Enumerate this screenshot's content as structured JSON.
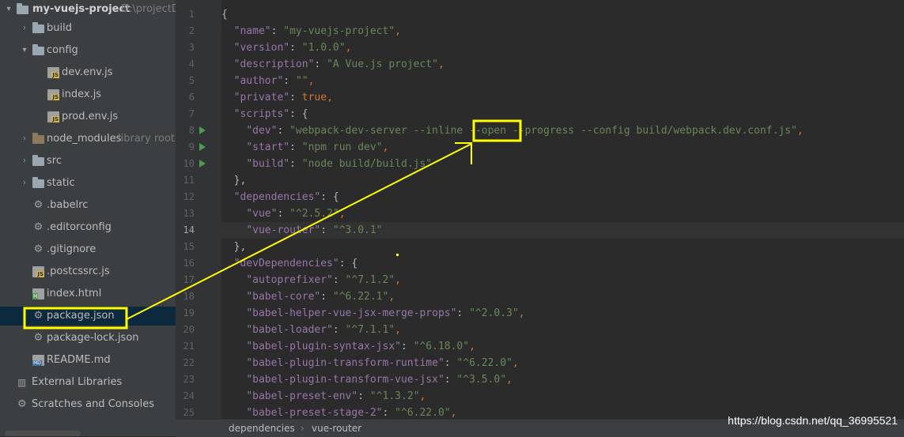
{
  "project_tree": {
    "root": {
      "name": "my-vuejs-project",
      "path": "D:\\projectDi"
    },
    "items": [
      {
        "label": "build",
        "kind": "folder",
        "expanded": false
      },
      {
        "label": "config",
        "kind": "folder",
        "expanded": true
      },
      {
        "label": "dev.env.js",
        "kind": "js"
      },
      {
        "label": "index.js",
        "kind": "js"
      },
      {
        "label": "prod.env.js",
        "kind": "js"
      },
      {
        "label": "node_modules",
        "kind": "folder-excluded",
        "note": "library root"
      },
      {
        "label": "src",
        "kind": "folder"
      },
      {
        "label": "static",
        "kind": "folder"
      },
      {
        "label": ".babelrc",
        "kind": "config"
      },
      {
        "label": ".editorconfig",
        "kind": "gear"
      },
      {
        "label": ".gitignore",
        "kind": "config"
      },
      {
        "label": ".postcssrc.js",
        "kind": "js"
      },
      {
        "label": "index.html",
        "kind": "html"
      },
      {
        "label": "package.json",
        "kind": "config",
        "selected": true
      },
      {
        "label": "package-lock.json",
        "kind": "config"
      },
      {
        "label": "README.md",
        "kind": "md"
      },
      {
        "label": "External Libraries",
        "kind": "library"
      },
      {
        "label": "Scratches and Consoles",
        "kind": "scratch"
      }
    ]
  },
  "editor": {
    "current_line": 14,
    "lines": [
      {
        "n": "1",
        "tokens": [
          [
            "p",
            "{"
          ]
        ]
      },
      {
        "n": "2",
        "tokens": [
          [
            "p",
            "  "
          ],
          [
            "key",
            "\"name\""
          ],
          [
            "p",
            ": "
          ],
          [
            "str",
            "\"my-vuejs-project\""
          ],
          [
            "kw",
            ","
          ]
        ]
      },
      {
        "n": "3",
        "tokens": [
          [
            "p",
            "  "
          ],
          [
            "key",
            "\"version\""
          ],
          [
            "p",
            ": "
          ],
          [
            "str",
            "\"1.0.0\""
          ],
          [
            "kw",
            ","
          ]
        ]
      },
      {
        "n": "4",
        "tokens": [
          [
            "p",
            "  "
          ],
          [
            "key",
            "\"description\""
          ],
          [
            "p",
            ": "
          ],
          [
            "str",
            "\"A Vue.js project\""
          ],
          [
            "kw",
            ","
          ]
        ]
      },
      {
        "n": "5",
        "tokens": [
          [
            "p",
            "  "
          ],
          [
            "key",
            "\"author\""
          ],
          [
            "p",
            ": "
          ],
          [
            "str",
            "\"\""
          ],
          [
            "kw",
            ","
          ]
        ]
      },
      {
        "n": "6",
        "tokens": [
          [
            "p",
            "  "
          ],
          [
            "key",
            "\"private\""
          ],
          [
            "p",
            ": "
          ],
          [
            "kw",
            "true"
          ],
          [
            "kw",
            ","
          ]
        ]
      },
      {
        "n": "7",
        "tokens": [
          [
            "p",
            "  "
          ],
          [
            "key",
            "\"scripts\""
          ],
          [
            "p",
            ": {"
          ]
        ]
      },
      {
        "n": "8",
        "run": true,
        "tokens": [
          [
            "p",
            "    "
          ],
          [
            "key",
            "\"dev\""
          ],
          [
            "p",
            ": "
          ],
          [
            "str",
            "\"webpack-dev-server --inline --open --progress --config build/webpack.dev.conf.js\""
          ],
          [
            "kw",
            ","
          ]
        ]
      },
      {
        "n": "9",
        "run": true,
        "tokens": [
          [
            "p",
            "    "
          ],
          [
            "key",
            "\"start\""
          ],
          [
            "p",
            ": "
          ],
          [
            "str",
            "\"npm run dev\""
          ],
          [
            "kw",
            ","
          ]
        ]
      },
      {
        "n": "10",
        "run": true,
        "tokens": [
          [
            "p",
            "    "
          ],
          [
            "key",
            "\"build\""
          ],
          [
            "p",
            ": "
          ],
          [
            "str",
            "\"node build/build.js\""
          ]
        ]
      },
      {
        "n": "11",
        "tokens": [
          [
            "p",
            "  },"
          ]
        ]
      },
      {
        "n": "12",
        "tokens": [
          [
            "p",
            "  "
          ],
          [
            "key",
            "\"dependencies\""
          ],
          [
            "p",
            ": {"
          ]
        ]
      },
      {
        "n": "13",
        "tokens": [
          [
            "p",
            "    "
          ],
          [
            "key",
            "\"vue\""
          ],
          [
            "p",
            ": "
          ],
          [
            "str",
            "\"^2.5.2\""
          ],
          [
            "kw",
            ","
          ]
        ]
      },
      {
        "n": "14",
        "tokens": [
          [
            "p",
            "    "
          ],
          [
            "key",
            "\"vue-router\""
          ],
          [
            "p",
            ": "
          ],
          [
            "str",
            "\"^3.0.1\""
          ]
        ]
      },
      {
        "n": "15",
        "tokens": [
          [
            "p",
            "  },"
          ]
        ]
      },
      {
        "n": "16",
        "tokens": [
          [
            "p",
            "  "
          ],
          [
            "key",
            "\"devDependencies\""
          ],
          [
            "p",
            ": {"
          ]
        ]
      },
      {
        "n": "17",
        "tokens": [
          [
            "p",
            "    "
          ],
          [
            "key",
            "\"autoprefixer\""
          ],
          [
            "p",
            ": "
          ],
          [
            "str",
            "\"^7.1.2\""
          ],
          [
            "kw",
            ","
          ]
        ]
      },
      {
        "n": "18",
        "tokens": [
          [
            "p",
            "    "
          ],
          [
            "key",
            "\"babel-core\""
          ],
          [
            "p",
            ": "
          ],
          [
            "str",
            "\"^6.22.1\""
          ],
          [
            "kw",
            ","
          ]
        ]
      },
      {
        "n": "19",
        "tokens": [
          [
            "p",
            "    "
          ],
          [
            "key",
            "\"babel-helper-vue-jsx-merge-props\""
          ],
          [
            "p",
            ": "
          ],
          [
            "str",
            "\"^2.0.3\""
          ],
          [
            "kw",
            ","
          ]
        ]
      },
      {
        "n": "20",
        "tokens": [
          [
            "p",
            "    "
          ],
          [
            "key",
            "\"babel-loader\""
          ],
          [
            "p",
            ": "
          ],
          [
            "str",
            "\"^7.1.1\""
          ],
          [
            "kw",
            ","
          ]
        ]
      },
      {
        "n": "21",
        "tokens": [
          [
            "p",
            "    "
          ],
          [
            "key",
            "\"babel-plugin-syntax-jsx\""
          ],
          [
            "p",
            ": "
          ],
          [
            "str",
            "\"^6.18.0\""
          ],
          [
            "kw",
            ","
          ]
        ]
      },
      {
        "n": "22",
        "tokens": [
          [
            "p",
            "    "
          ],
          [
            "key",
            "\"babel-plugin-transform-runtime\""
          ],
          [
            "p",
            ": "
          ],
          [
            "str",
            "\"^6.22.0\""
          ],
          [
            "kw",
            ","
          ]
        ]
      },
      {
        "n": "23",
        "tokens": [
          [
            "p",
            "    "
          ],
          [
            "key",
            "\"babel-plugin-transform-vue-jsx\""
          ],
          [
            "p",
            ": "
          ],
          [
            "str",
            "\"^3.5.0\""
          ],
          [
            "kw",
            ","
          ]
        ]
      },
      {
        "n": "24",
        "tokens": [
          [
            "p",
            "    "
          ],
          [
            "key",
            "\"babel-preset-env\""
          ],
          [
            "p",
            ": "
          ],
          [
            "str",
            "\"^1.3.2\""
          ],
          [
            "kw",
            ","
          ]
        ]
      },
      {
        "n": "25",
        "tokens": [
          [
            "p",
            "    "
          ],
          [
            "key",
            "\"babel-preset-stage-2\""
          ],
          [
            "p",
            ": "
          ],
          [
            "str",
            "\"^6.22.0\""
          ],
          [
            "kw",
            ","
          ]
        ]
      }
    ]
  },
  "breadcrumb": {
    "items": [
      "dependencies",
      "vue-router"
    ],
    "separator": "›"
  },
  "watermark": "https://blog.csdn.net/qq_36995521",
  "annotation_color": "#ffff00"
}
